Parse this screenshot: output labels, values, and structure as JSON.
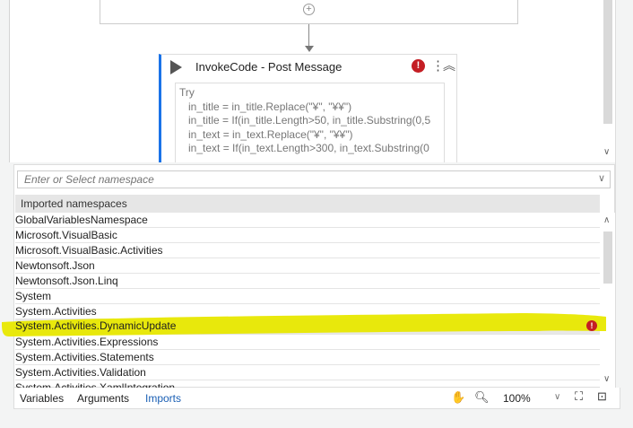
{
  "designer": {
    "activity": {
      "title": "InvokeCode - Post Message",
      "code_lines": [
        "Try",
        "   in_title = in_title.Replace(\"¥\", \"¥¥\")",
        "   in_title = If(in_title.Length>50, in_title.Substring(0,5",
        "   in_text = in_text.Replace(\"¥\", \"¥¥\")",
        "   in_text = If(in_text.Length>300, in_text.Substring(0"
      ]
    }
  },
  "imports": {
    "input_placeholder": "Enter or Select namespace",
    "header": "Imported namespaces",
    "namespaces": [
      "GlobalVariablesNamespace",
      "Microsoft.VisualBasic",
      "Microsoft.VisualBasic.Activities",
      "Newtonsoft.Json",
      "Newtonsoft.Json.Linq",
      "System",
      "System.Activities",
      "System.Activities.DynamicUpdate",
      "System.Activities.Expressions",
      "System.Activities.Statements",
      "System.Activities.Validation",
      "System.Activities.XamlIntegration"
    ],
    "error_row": "System.Activities.DynamicUpdate",
    "highlight_color": "#e8e800"
  },
  "bottom": {
    "tabs": [
      "Variables",
      "Arguments",
      "Imports"
    ],
    "active_tab": "Imports",
    "zoom": "100%"
  }
}
